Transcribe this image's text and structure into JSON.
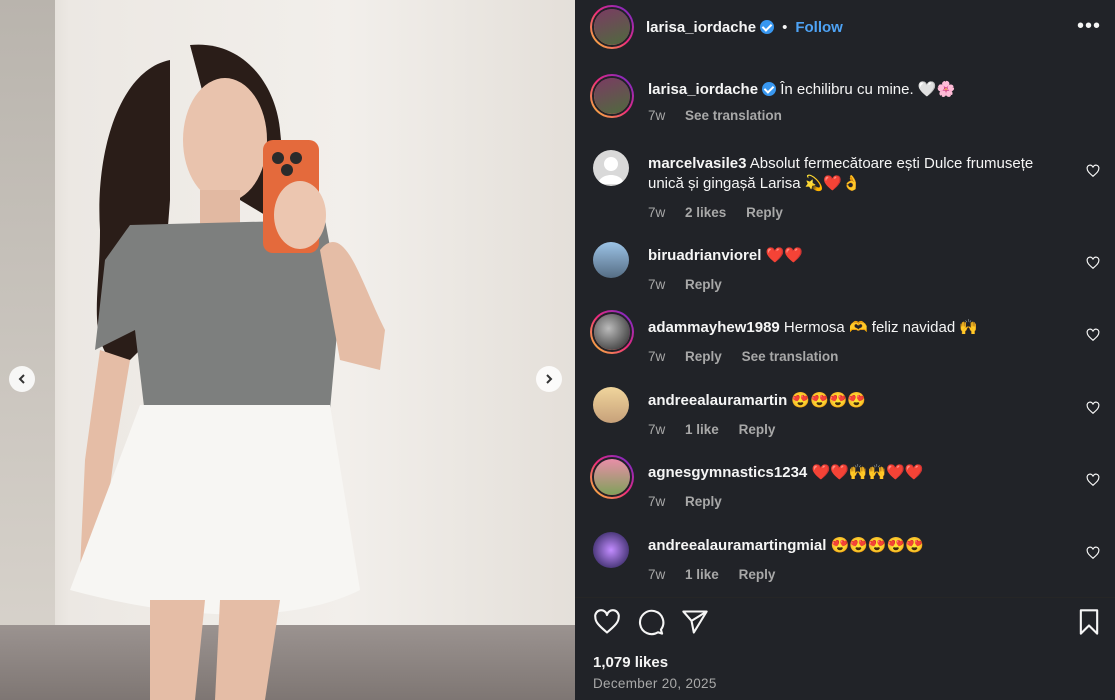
{
  "post": {
    "author": "larisa_iordache",
    "follow_label": "Follow",
    "more_label": "•••",
    "caption": "În echilibru cu mine. 🤍🌸",
    "caption_time": "7w",
    "see_translation": "See translation"
  },
  "comments": [
    {
      "user": "marcelvasile3",
      "text": "Absolut fermecătoare ești Dulce frumusețe unică și gingașă Larisa 💫❤️👌",
      "time": "7w",
      "likes": "2 likes",
      "reply": "Reply",
      "translate": ""
    },
    {
      "user": "biruadrianviorel",
      "text": "❤️❤️",
      "time": "7w",
      "likes": "",
      "reply": "Reply",
      "translate": ""
    },
    {
      "user": "adammayhew1989",
      "text": "Hermosa 🫶 feliz navidad 🙌",
      "time": "7w",
      "likes": "",
      "reply": "Reply",
      "translate": "See translation"
    },
    {
      "user": "andreealauramartin",
      "text": "😍😍😍😍",
      "time": "7w",
      "likes": "1 like",
      "reply": "Reply",
      "translate": ""
    },
    {
      "user": "agnesgymnastics1234",
      "text": "❤️❤️🙌🙌❤️❤️",
      "time": "7w",
      "likes": "",
      "reply": "Reply",
      "translate": ""
    },
    {
      "user": "andreealauramartingmial",
      "text": "😍😍😍😍😍",
      "time": "7w",
      "likes": "1 like",
      "reply": "Reply",
      "translate": ""
    }
  ],
  "footer": {
    "likes": "1,079 likes",
    "date": "December 20, 2025"
  },
  "icons": {
    "like": "heart-icon",
    "comment": "comment-icon",
    "share": "share-icon",
    "save": "bookmark-icon",
    "prev": "chevron-left-icon",
    "next": "chevron-right-icon"
  },
  "colors": {
    "panel": "#212328",
    "link": "#4ea3f5",
    "verified": "#3897f0",
    "muted": "#a8a8a8"
  }
}
